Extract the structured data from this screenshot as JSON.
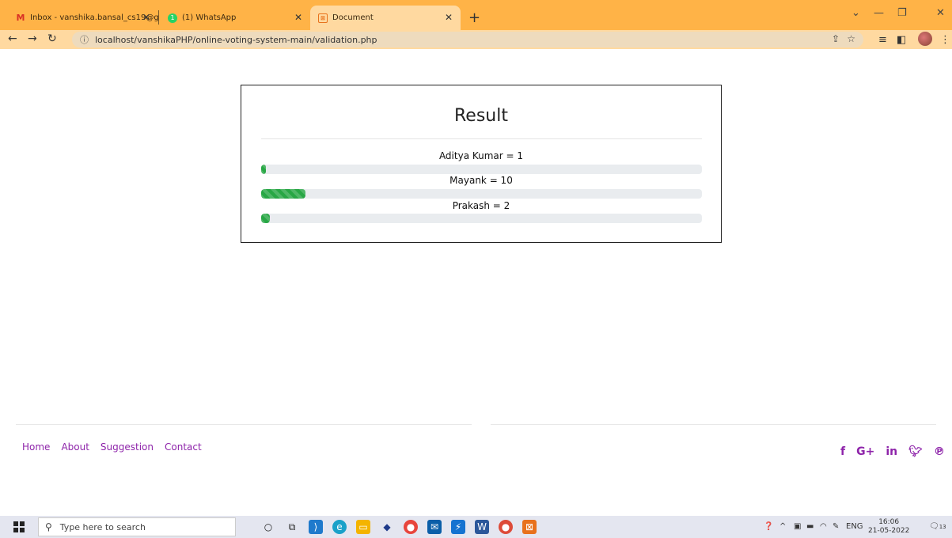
{
  "browser": {
    "tabs": [
      {
        "title": "Inbox - vanshika.bansal_cs19@gl",
        "icon": "gmail-icon"
      },
      {
        "title": "(1) WhatsApp",
        "icon": "whatsapp-icon",
        "badge": "1"
      },
      {
        "title": "Document",
        "icon": "document-icon"
      }
    ],
    "url": "localhost/vanshikaPHP/online-voting-system-main/validation.php"
  },
  "result": {
    "title": "Result",
    "candidates": [
      {
        "label": "Aditya Kumar = 1",
        "name": "Aditya Kumar",
        "votes": 1,
        "bar_percent": 1
      },
      {
        "label": "Mayank = 10",
        "name": "Mayank",
        "votes": 10,
        "bar_percent": 10
      },
      {
        "label": "Prakash = 2",
        "name": "Prakash",
        "votes": 2,
        "bar_percent": 2
      }
    ],
    "bar_color": "#28a745"
  },
  "footer": {
    "links": [
      "Home",
      "About",
      "Suggestion",
      "Contact"
    ],
    "social": [
      "facebook-icon",
      "google-plus-icon",
      "linkedin-icon",
      "twitter-icon",
      "pinterest-icon"
    ],
    "link_color": "#8e24aa"
  },
  "taskbar": {
    "search_placeholder": "Type here to search",
    "lang": "ENG",
    "time": "16:06",
    "date": "21-05-2022",
    "notification_count": "13"
  }
}
